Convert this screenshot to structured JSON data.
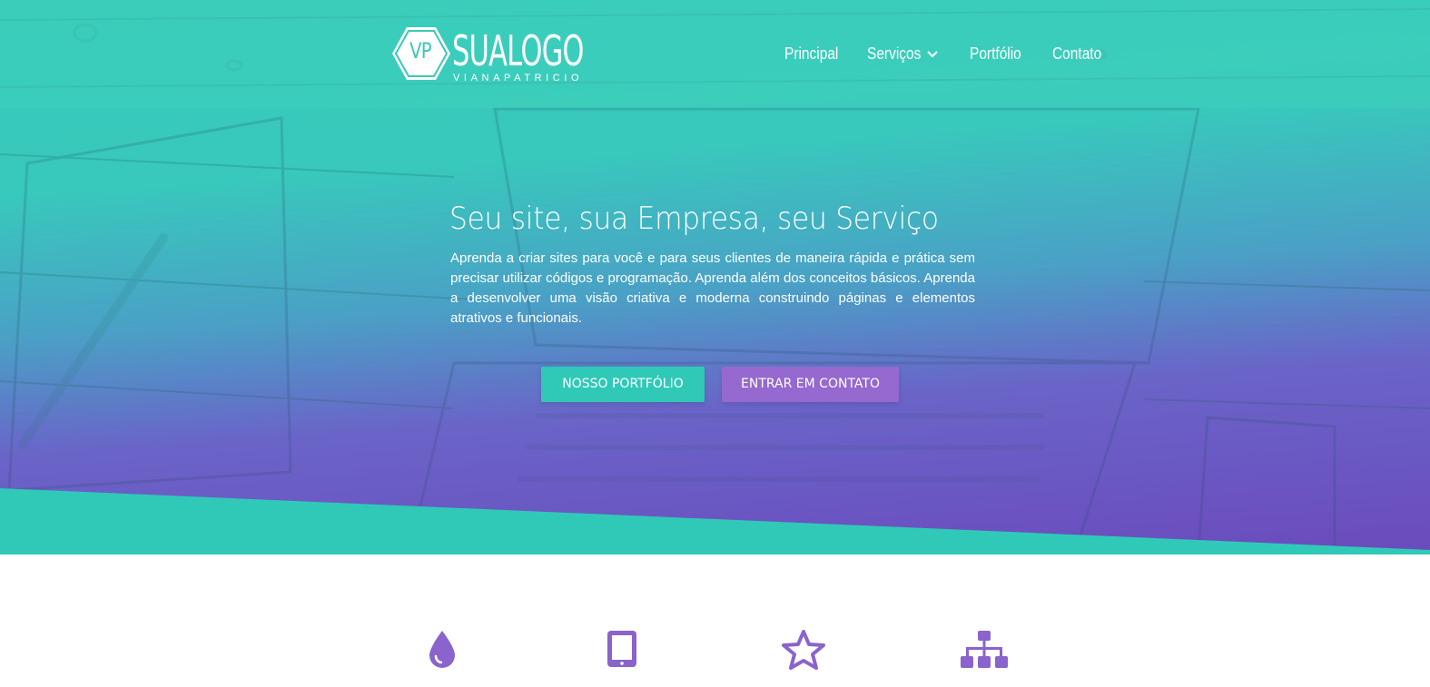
{
  "brand": {
    "initials": "VP",
    "name": "SUALOGO",
    "tagline": "VIANAPATRICIO"
  },
  "nav": {
    "items": [
      {
        "label": "Principal",
        "has_dropdown": false
      },
      {
        "label": "Serviços",
        "has_dropdown": true
      },
      {
        "label": "Portfólio",
        "has_dropdown": false
      },
      {
        "label": "Contato",
        "has_dropdown": false
      }
    ],
    "dropdown_icon": "chevron-down-icon"
  },
  "hero": {
    "title": "Seu site, sua Empresa, seu Serviço",
    "text": "Aprenda a criar sites para você e para seus clientes de maneira rápida e prática sem precisar utilizar códigos e programação. Aprenda além dos conceitos básicos. Aprenda a desenvolver uma visão criativa e moderna construindo páginas e elementos atrativos e funcionais.",
    "buttons": {
      "portfolio": "NOSSO PORTFÓLIO",
      "contact": "ENTRAR EM CONTATO"
    }
  },
  "features": {
    "icons": [
      "drop-icon",
      "tablet-icon",
      "star-icon",
      "sitemap-icon"
    ]
  },
  "colors": {
    "teal": "#30c9b8",
    "purple": "#9569d0",
    "icon_purple": "#8a63cc",
    "white": "#ffffff"
  }
}
